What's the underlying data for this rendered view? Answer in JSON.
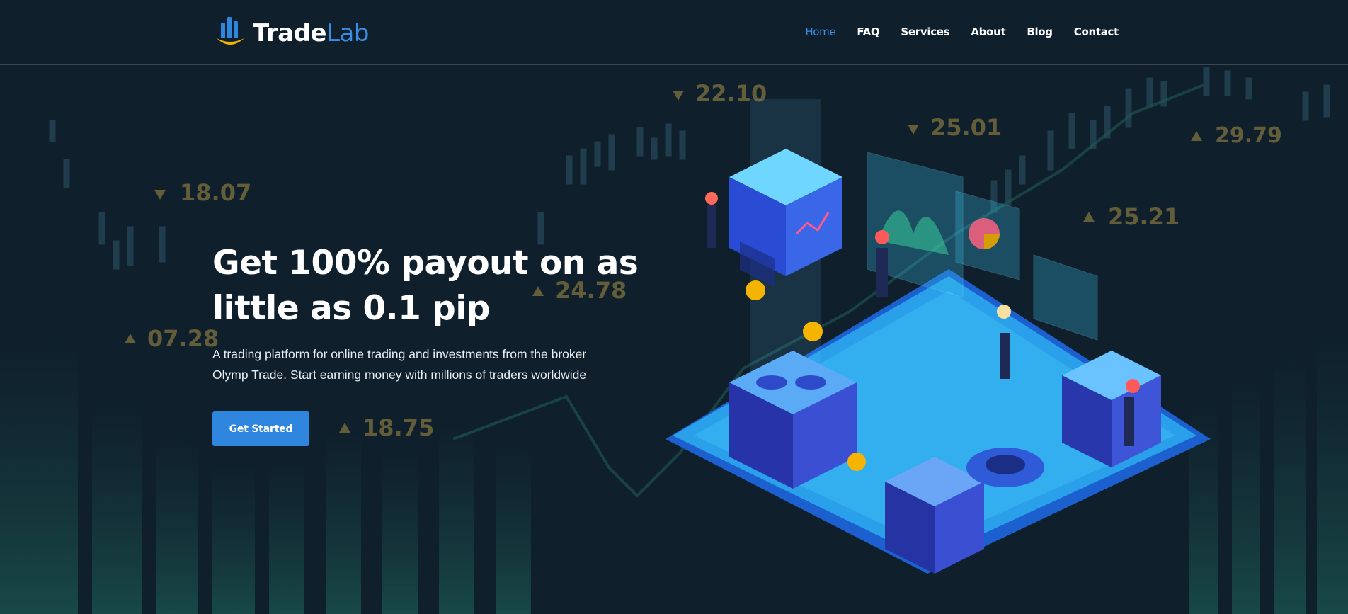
{
  "brand": {
    "name_part1": "Trade",
    "name_part2": "Lab"
  },
  "nav": {
    "items": [
      {
        "label": "Home",
        "active": true
      },
      {
        "label": "FAQ",
        "active": false
      },
      {
        "label": "Services",
        "active": false
      },
      {
        "label": "About",
        "active": false
      },
      {
        "label": "Blog",
        "active": false
      },
      {
        "label": "Contact",
        "active": false
      }
    ]
  },
  "hero": {
    "title_line1": "Get 100% payout on as",
    "title_line2": "little as 0.1 pip",
    "description_line1": "A trading platform for online trading and investments from the broker",
    "description_line2": "Olymp Trade. Start earning money with millions of traders worldwide",
    "cta_label": "Get Started"
  },
  "background_prices": [
    "22.10",
    "25.01",
    "29.79",
    "18.07",
    "25.21",
    "24.78",
    "07.28",
    "18.75"
  ],
  "colors": {
    "accent": "#2f86de",
    "background": "#0f1f2c",
    "price_gold": "#c9a94a"
  },
  "icons": {
    "logo": "bar-chart-smile-icon",
    "price_up": "triangle-up-icon",
    "price_down": "triangle-down-icon"
  }
}
